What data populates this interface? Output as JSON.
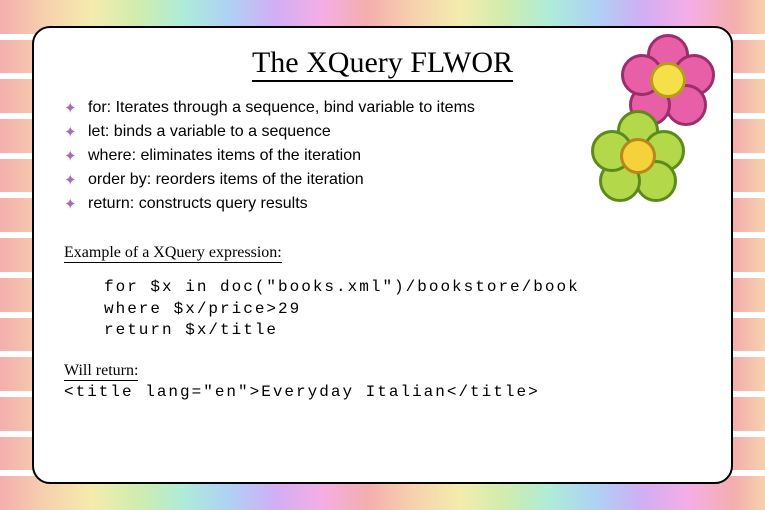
{
  "title": "The XQuery FLWOR",
  "bullets": [
    "for: Iterates through a sequence, bind variable to items",
    "let: binds a variable to a sequence",
    "where: eliminates items of the iteration",
    "order by: reorders items of the iteration",
    "return: constructs query results"
  ],
  "example_label": "Example of a XQuery expression:",
  "code": "for $x in doc(\"books.xml\")/bookstore/book\nwhere $x/price>29\nreturn $x/title",
  "will_return_label": "Will return:",
  "result_code": "<title lang=\"en\">Everyday Italian</title>"
}
